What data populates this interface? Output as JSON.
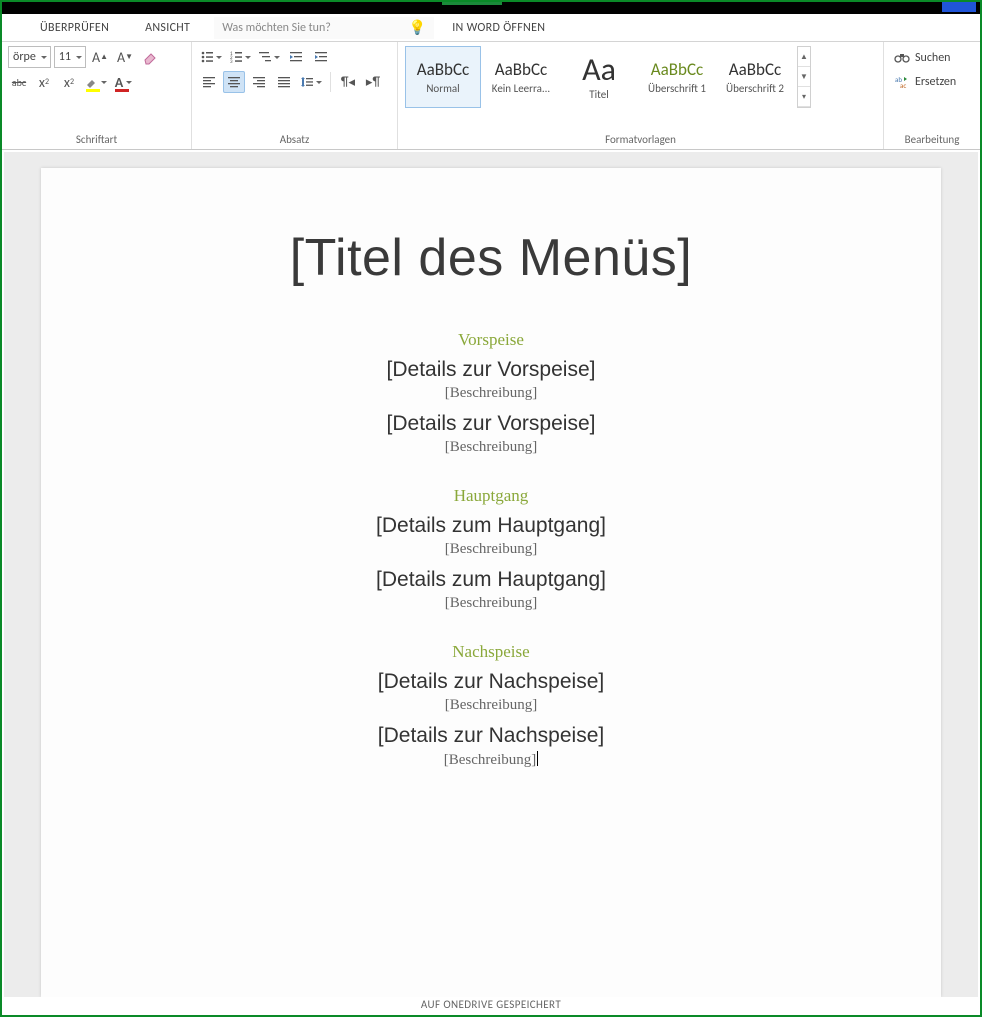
{
  "tabs": {
    "review": "ÜBERPRÜFEN",
    "view": "ANSICHT"
  },
  "tellme_placeholder": "Was möchten Sie tun?",
  "open_in_word": "IN WORD ÖFFNEN",
  "font": {
    "name_fragment": "örpe",
    "size": "11",
    "group_label": "Schriftart"
  },
  "paragraph": {
    "group_label": "Absatz"
  },
  "styles": {
    "group_label": "Formatvorlagen",
    "items": [
      {
        "sample": "AaBbCc",
        "label": "Normal",
        "class": "",
        "selected": true
      },
      {
        "sample": "AaBbCc",
        "label": "Kein Leerra...",
        "class": "",
        "selected": false
      },
      {
        "sample": "Aa",
        "label": "Titel",
        "class": "big",
        "selected": false
      },
      {
        "sample": "AaBbCc",
        "label": "Überschrift 1",
        "class": "green",
        "selected": false
      },
      {
        "sample": "AaBbCc",
        "label": "Überschrift 2",
        "class": "",
        "selected": false
      }
    ]
  },
  "editing": {
    "find": "Suchen",
    "replace": "Ersetzen",
    "group_label": "Bearbeitung"
  },
  "document": {
    "title": "[Titel des Menüs]",
    "sections": [
      {
        "heading": "Vorspeise",
        "items": [
          {
            "title": "[Details zur Vorspeise]",
            "desc": "[Beschreibung]"
          },
          {
            "title": "[Details zur Vorspeise]",
            "desc": "[Beschreibung]"
          }
        ]
      },
      {
        "heading": "Hauptgang",
        "items": [
          {
            "title": "[Details zum Hauptgang]",
            "desc": "[Beschreibung]"
          },
          {
            "title": "[Details zum Hauptgang]",
            "desc": "[Beschreibung]"
          }
        ]
      },
      {
        "heading": "Nachspeise",
        "items": [
          {
            "title": "[Details zur Nachspeise]",
            "desc": "[Beschreibung]"
          },
          {
            "title": "[Details zur Nachspeise]",
            "desc": "[Beschreibung]",
            "cursor": true
          }
        ]
      }
    ]
  },
  "status": "AUF ONEDRIVE GESPEICHERT"
}
